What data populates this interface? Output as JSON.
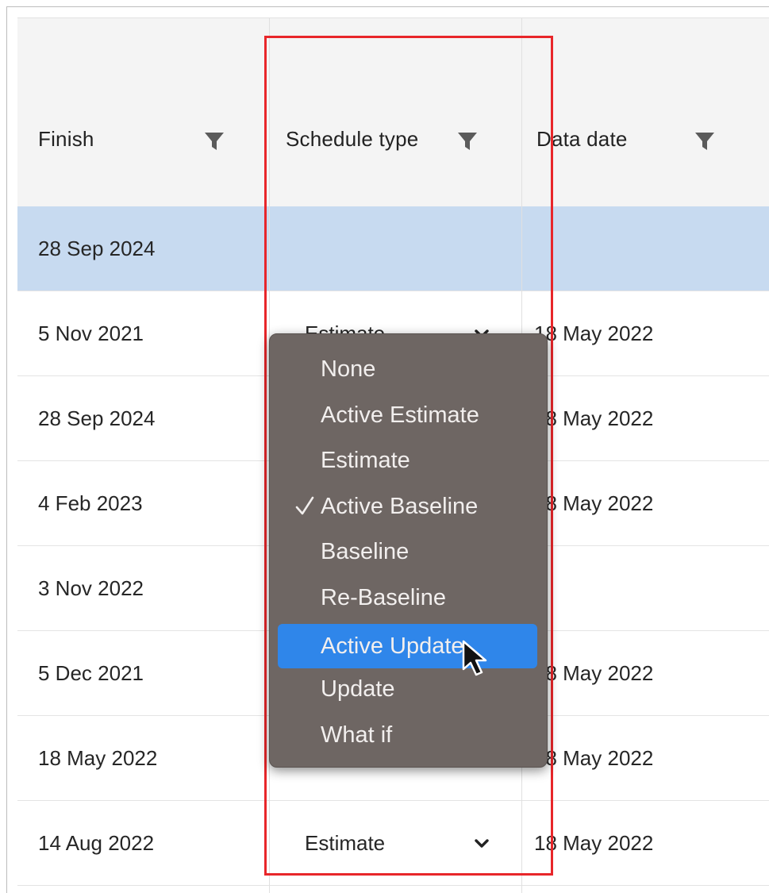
{
  "columns": {
    "finish": "Finish",
    "schedule_type": "Schedule type",
    "data_date": "Data date"
  },
  "rows": [
    {
      "finish": "28 Sep 2024",
      "schedule_type": "",
      "data_date": "",
      "selected": true
    },
    {
      "finish": "5 Nov 2021",
      "schedule_type": "Estimate",
      "data_date": "18 May 2022"
    },
    {
      "finish": "28 Sep 2024",
      "schedule_type": "",
      "data_date": "18 May 2022"
    },
    {
      "finish": "4 Feb 2023",
      "schedule_type": "",
      "data_date": "18 May 2022"
    },
    {
      "finish": "3 Nov 2022",
      "schedule_type": "",
      "data_date": ""
    },
    {
      "finish": "5 Dec 2021",
      "schedule_type": "",
      "data_date": "18 May 2022"
    },
    {
      "finish": "18 May 2022",
      "schedule_type": "",
      "data_date": "18 May 2022"
    },
    {
      "finish": "14 Aug 2022",
      "schedule_type": "Estimate",
      "data_date": "18 May 2022"
    }
  ],
  "schedule_menu": {
    "options": [
      "None",
      "Active Estimate",
      "Estimate",
      "Active Baseline",
      "Baseline",
      "Re-Baseline",
      "Active Update",
      "Update",
      "What if"
    ],
    "checked": "Active Baseline",
    "hovered": "Active Update"
  },
  "colors": {
    "highlight_box": "#e8262a",
    "selected_row": "#c7daf0",
    "menu_background": "#6e6663",
    "menu_hover": "#2f86ea"
  },
  "icons": {
    "filter": "filter-funnel-icon",
    "dropdown": "chevron-down-icon",
    "check": "checkmark-icon",
    "cursor": "mouse-pointer-icon"
  }
}
